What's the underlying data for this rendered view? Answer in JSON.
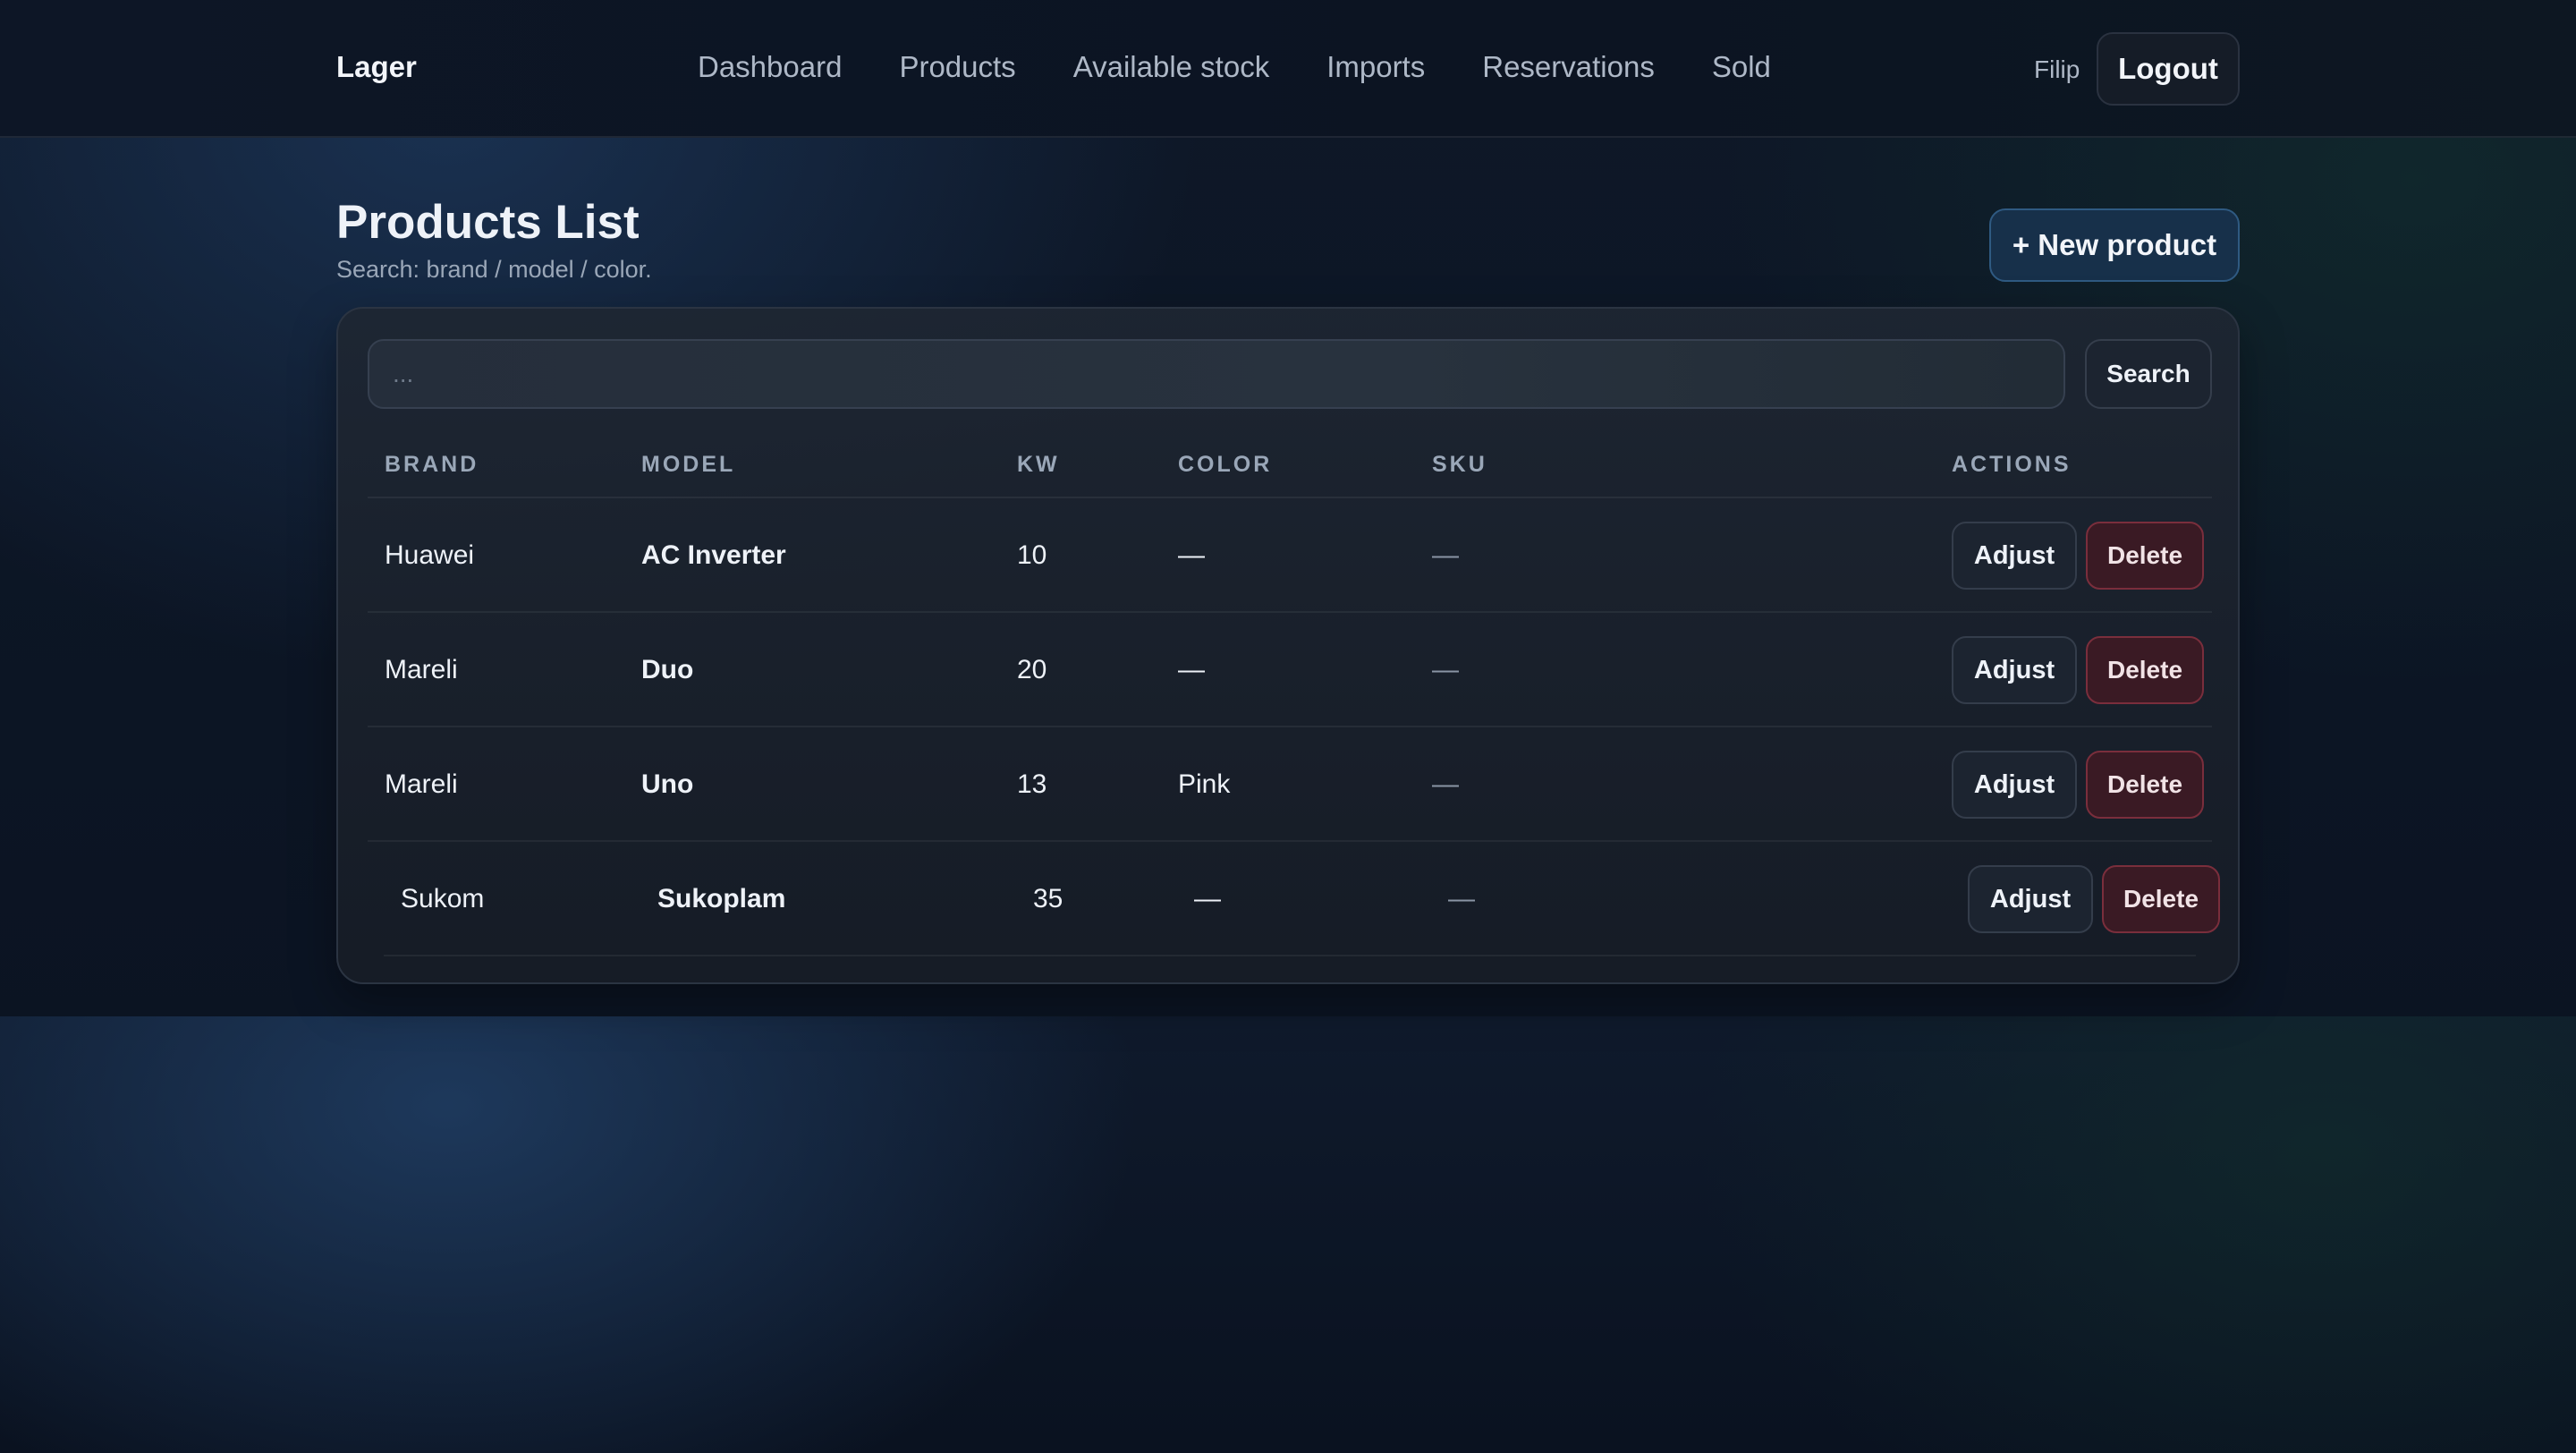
{
  "navbar": {
    "brand": "Lager",
    "links": [
      "Dashboard",
      "Products",
      "Available stock",
      "Imports",
      "Reservations",
      "Sold"
    ],
    "user": "Filip",
    "logout_label": "Logout"
  },
  "header": {
    "title": "Products List",
    "subtitle": "Search: brand / model / color.",
    "new_product_label": "+ New product"
  },
  "search": {
    "placeholder": "...",
    "value": "",
    "button_label": "Search"
  },
  "table": {
    "columns": [
      "Brand",
      "Model",
      "KW",
      "Color",
      "SKU",
      "Actions"
    ],
    "rows": [
      {
        "brand": "Huawei",
        "model": "AC Inverter",
        "kw": "10",
        "color": "—",
        "sku": "—"
      },
      {
        "brand": "Mareli",
        "model": "Duo",
        "kw": "20",
        "color": "—",
        "sku": "—"
      },
      {
        "brand": "Mareli",
        "model": "Uno",
        "kw": "13",
        "color": "Pink",
        "sku": "—"
      },
      {
        "brand": "Sukom",
        "model": "Sukoplam",
        "kw": "35",
        "color": "—",
        "sku": "—"
      }
    ],
    "adjust_label": "Adjust",
    "delete_label": "Delete"
  },
  "colors": {
    "background": "#0b1220",
    "accent": "#2f5a82",
    "danger": "#7a2e3c"
  }
}
